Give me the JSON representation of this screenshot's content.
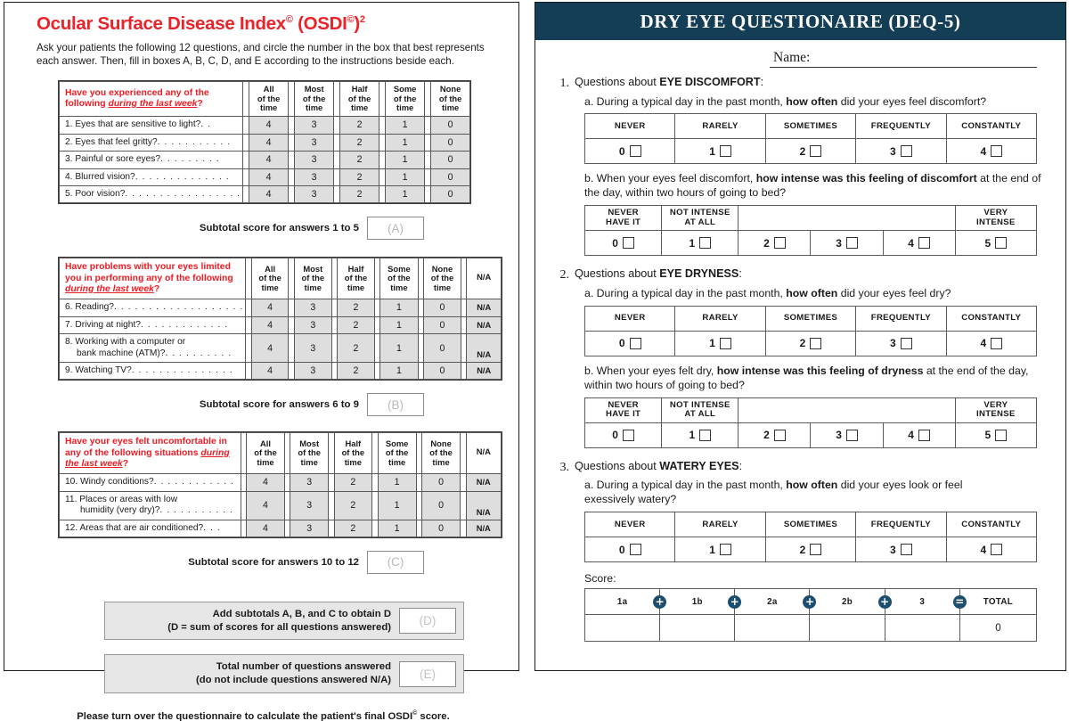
{
  "osdi": {
    "title": "Ocular Surface Disease Index",
    "title_sup1": "©",
    "title_mid": " (OSDI",
    "title_sup2": "©",
    "title_end": ")",
    "title_sup3": "2",
    "instructions": "Ask your patients the following 12 questions, and circle the number in the box that best represents each answer. Then, fill in boxes A, B, C, D, and E according to the instructions beside each.",
    "col_headers": [
      {
        "l1": "All",
        "l2": "of the",
        "l3": "time"
      },
      {
        "l1": "Most",
        "l2": "of the",
        "l3": "time"
      },
      {
        "l1": "Half",
        "l2": "of the",
        "l3": "time"
      },
      {
        "l1": "Some",
        "l2": "of the",
        "l3": "time"
      },
      {
        "l1": "None",
        "l2": "of the",
        "l3": "time"
      }
    ],
    "na_header": "N/A",
    "na_value": "N/A",
    "values": [
      "4",
      "3",
      "2",
      "1",
      "0"
    ],
    "section1": {
      "header_pre": "Have you experienced any of the following ",
      "header_em": "during the last week",
      "header_post": "?",
      "rows": [
        {
          "n": "1.",
          "text": "Eyes that are sensitive to light?",
          "dots": ". ."
        },
        {
          "n": "2.",
          "text": "Eyes that feel gritty?",
          "dots": ". . . . . . . . . . ."
        },
        {
          "n": "3.",
          "text": "Painful or sore eyes?",
          "dots": ". . . . . . . . ."
        },
        {
          "n": "4.",
          "text": "Blurred vision?",
          "dots": ". . . . . . . . . . . . . ."
        },
        {
          "n": "5.",
          "text": "Poor vision?",
          "dots": ". . . . . . . . . . . . . . . . ."
        }
      ],
      "subtotal_label": "Subtotal score for answers 1 to 5",
      "subtotal_box": "(A)"
    },
    "section2": {
      "header_pre": "Have problems with your eyes limited you in performing any of the following ",
      "header_em": "during the last week",
      "header_post": "?",
      "rows": [
        {
          "n": "6.",
          "text": "Reading?",
          "dots": ". . . . . . . . . . . . . . . . . . ."
        },
        {
          "n": "7.",
          "text": "Driving at night?",
          "dots": ". . . . . . . . . . . . ."
        },
        {
          "n": "8.",
          "text": "Working with a computer or",
          "text2": "bank machine (ATM)?",
          "dots2": ". . . . . . . . . ."
        },
        {
          "n": "9.",
          "text": "Watching TV?",
          "dots": ". . . . . . . . . . . . . . ."
        }
      ],
      "subtotal_label": "Subtotal score for answers 6 to 9",
      "subtotal_box": "(B)"
    },
    "section3": {
      "header_pre": "Have your eyes felt uncomfortable in any of the following situations ",
      "header_em": "during the last week",
      "header_post": "?",
      "rows": [
        {
          "n": "10.",
          "text": "Windy conditions?",
          "dots": ". . . . . . . . . . . ."
        },
        {
          "n": "11.",
          "text": "Places or areas with low",
          "text2": "humidity (very dry)?",
          "dots2": ". . . . . . . . . . ."
        },
        {
          "n": "12.",
          "text": "Areas that are air conditioned?",
          "dots": ". . ."
        }
      ],
      "subtotal_label": "Subtotal score for answers 10 to 12",
      "subtotal_box": "(C)"
    },
    "sum_d": {
      "line1": "Add subtotals A, B, and C to obtain D",
      "line2": "(D = sum of scores for all questions answered)",
      "box": "(D)"
    },
    "sum_e": {
      "line1": "Total number of questions answered",
      "line2": "(do not include questions answered N/A)",
      "box": "(E)"
    },
    "footer_pre": "Please turn over the questionnaire to calculate the patient's final OSDI",
    "footer_sup": "©",
    "footer_post": " score."
  },
  "deq": {
    "header_title": "DRY EYE QUESTIONAIRE (DEQ-5)",
    "header_color": "#143d56",
    "name_label": "Name:",
    "freq_headers": [
      "NEVER",
      "RARELY",
      "SOMETIMES",
      "FREQUENTLY",
      "CONSTANTLY"
    ],
    "freq_values": [
      "0",
      "1",
      "2",
      "3",
      "4"
    ],
    "intensity_headers": [
      {
        "l1": "NEVER",
        "l2": "HAVE IT"
      },
      {
        "l1": "NOT INTENSE",
        "l2": "AT ALL"
      },
      {
        "l1": "",
        "l2": ""
      },
      {
        "l1": "VERY",
        "l2": "INTENSE"
      }
    ],
    "intensity_values": [
      "0",
      "1",
      "2",
      "3",
      "4",
      "5"
    ],
    "q1": {
      "num": "1.",
      "title_pre": "Questions about ",
      "title_bold": "EYE DISCOMFORT",
      "title_post": ":",
      "a_pre": "a. During a typical day in the past month, ",
      "a_bold": "how often",
      "a_post": " did your eyes feel discomfort?",
      "b_pre": "b. When your eyes feel discomfort, ",
      "b_bold": "how intense was this feeling of discomfort",
      "b_post": " at the end of the day, within two hours of going to bed?"
    },
    "q2": {
      "num": "2.",
      "title_pre": "Questions about ",
      "title_bold": "EYE DRYNESS",
      "title_post": ":",
      "a_pre": "a. During a typical day in the past month, ",
      "a_bold": "how often",
      "a_post": " did your eyes feel dry?",
      "b_pre": "b. When your eyes felt dry, ",
      "b_bold": "how intense was this feeling of dryness",
      "b_post": " at the end of the day, within two hours of going to bed?"
    },
    "q3": {
      "num": "3.",
      "title_pre": "Questions about ",
      "title_bold": "WATERY EYES",
      "title_post": ":",
      "a_pre": "a. During a typical day in the past month, ",
      "a_bold": "how often",
      "a_post": " did your eyes look or feel exessively watery?"
    },
    "score": {
      "label": "Score:",
      "columns": [
        "1a",
        "1b",
        "2a",
        "2b",
        "3",
        "TOTAL"
      ],
      "operators": [
        "plus-icon",
        "plus-icon",
        "plus-icon",
        "plus-icon",
        "equals-icon"
      ],
      "values": [
        "",
        "",
        "",
        "",
        "",
        "0"
      ],
      "operator_color": "#1d4e70"
    }
  }
}
